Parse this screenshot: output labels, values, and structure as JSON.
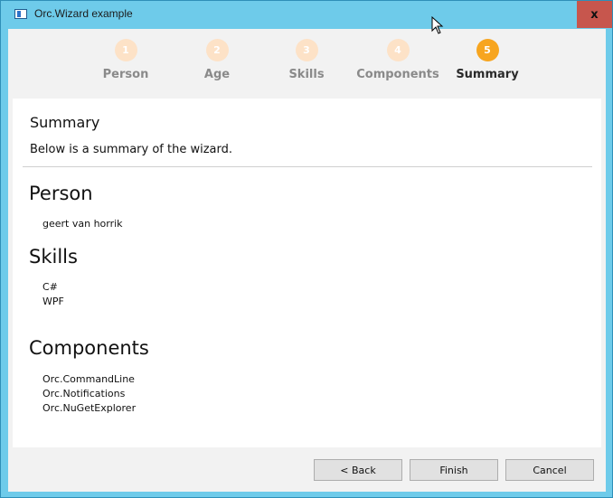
{
  "window": {
    "title": "Orc.Wizard example",
    "close_label": "x"
  },
  "wizard": {
    "steps": [
      {
        "number": "1",
        "label": "Person"
      },
      {
        "number": "2",
        "label": "Age"
      },
      {
        "number": "3",
        "label": "Skills"
      },
      {
        "number": "4",
        "label": "Components"
      },
      {
        "number": "5",
        "label": "Summary"
      }
    ],
    "active_step": 5
  },
  "page": {
    "title": "Summary",
    "description": "Below is a summary of the wizard."
  },
  "summary": {
    "person_heading": "Person",
    "person_items": [
      "geert van horrik"
    ],
    "skills_heading": "Skills",
    "skills_items": [
      "C#",
      "WPF"
    ],
    "components_heading": "Components",
    "components_items": [
      "Orc.CommandLine",
      "Orc.Notifications",
      "Orc.NuGetExplorer"
    ]
  },
  "buttons": {
    "back": "< Back",
    "finish": "Finish",
    "cancel": "Cancel"
  },
  "colors": {
    "window_accent": "#6ecbea",
    "close_button": "#c7564d",
    "active_step": "#f7a51f",
    "inactive_step": "#fde2c7"
  },
  "icons": {
    "app": "app-icon",
    "close": "close-icon",
    "cursor": "mouse-cursor-icon"
  }
}
